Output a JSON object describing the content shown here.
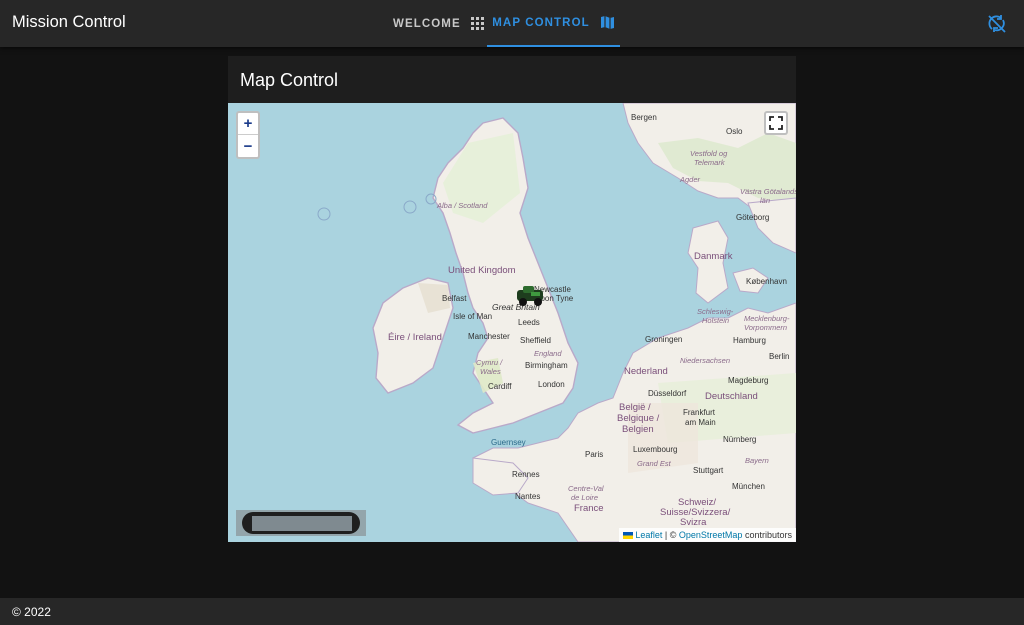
{
  "app": {
    "title": "Mission Control"
  },
  "tabs": [
    {
      "label": "WELCOME",
      "icon": "grid-icon",
      "active": false
    },
    {
      "label": "MAP CONTROL",
      "icon": "map-icon",
      "active": true
    }
  ],
  "header": {
    "sync_icon": "sync-off-icon"
  },
  "card": {
    "title": "Map Control"
  },
  "map": {
    "zoom_in_label": "+",
    "zoom_out_label": "−",
    "attribution": {
      "leaflet": "Leaflet",
      "separator": "| ©",
      "osm": "OpenStreetMap",
      "suffix": "contributors"
    },
    "labels": {
      "bergen": "Bergen",
      "oslo": "Oslo",
      "vestfold": "Vestfold og",
      "telemark": "Telemark",
      "agder": "Agder",
      "vastra": "Västra Götalands",
      "lan": "län",
      "goteborg": "Göteborg",
      "alba": "Alba / Scotland",
      "uk": "United Kingdom",
      "danmark": "Danmark",
      "kobenhavn": "København",
      "newcastle": "Newcastle",
      "upon_tyne": "upon Tyne",
      "belfast": "Belfast",
      "great_britain": "Great Britain",
      "isle_of_man": "Isle of Man",
      "leeds": "Leeds",
      "eire": "Éire / Ireland",
      "manchester": "Manchester",
      "sheffield": "Sheffield",
      "england": "England",
      "birmingham": "Birmingham",
      "cymru": "Cymru /",
      "wales": "Wales",
      "cardiff": "Cardiff",
      "london": "London",
      "schleswig": "Schleswig-",
      "holstein": "Holstein",
      "mecklenburg": "Mecklenburg-",
      "vorpommern": "Vorpommern",
      "groningen": "Groningen",
      "hamburg": "Hamburg",
      "berlin": "Berlin",
      "niedersachsen": "Niedersachsen",
      "nederland": "Nederland",
      "magdeburg": "Magdeburg",
      "deutschland": "Deutschland",
      "dusseldorf": "Düsseldorf",
      "belgie": "België /",
      "belgique": "Belgique /",
      "belgien": "Belgien",
      "frankfurt": "Frankfurt",
      "am_main": "am Main",
      "guernsey": "Guernsey",
      "luxembourg": "Luxembourg",
      "nurnberg": "Nürnberg",
      "paris": "Paris",
      "bayern": "Bayern",
      "grand_est": "Grand Est",
      "stuttgart": "Stuttgart",
      "rennes": "Rennes",
      "munchen": "München",
      "centre": "Centre-Val",
      "de_loire": "de Loire",
      "nantes": "Nantes",
      "schweiz": "Schweiz/",
      "suisse": "Suisse/Svizzera/",
      "svizra": "Svizra",
      "france": "France"
    }
  },
  "footer": {
    "copyright": "© 2022"
  },
  "colors": {
    "accent": "#2f8fe0",
    "sea": "#aad3df",
    "land": "#f2efe9",
    "header": "#272727",
    "background": "#121212"
  }
}
